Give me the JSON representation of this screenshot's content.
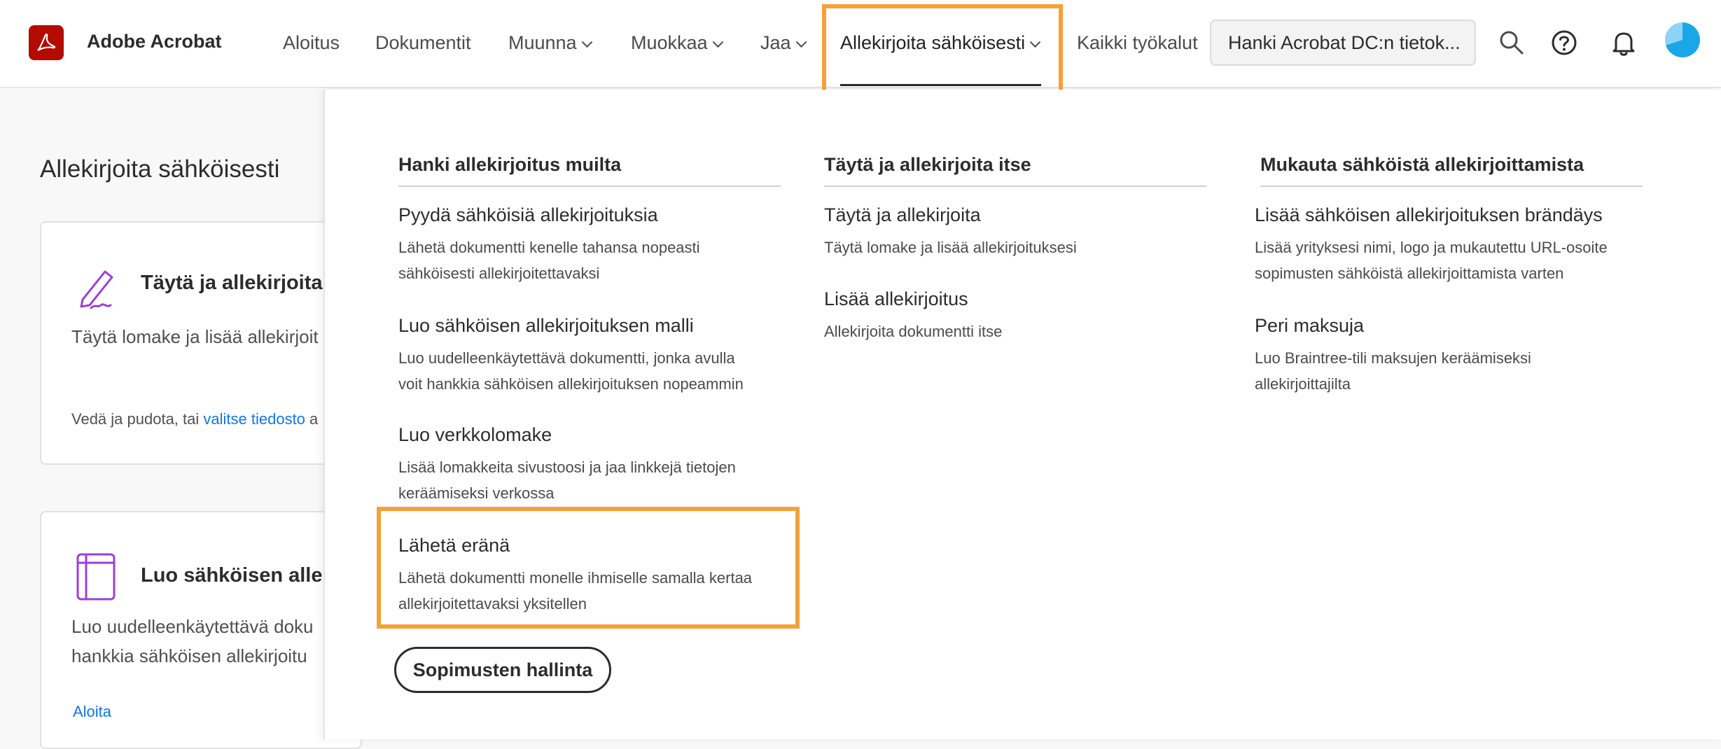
{
  "header": {
    "brand": "Adobe Acrobat",
    "nav": [
      {
        "label": "Aloitus"
      },
      {
        "label": "Dokumentit"
      },
      {
        "label": "Muunna"
      },
      {
        "label": "Muokkaa"
      },
      {
        "label": "Jaa"
      },
      {
        "label": "Allekirjoita sähköisesti"
      },
      {
        "label": "Kaikki työkalut"
      }
    ],
    "cta": "Hanki Acrobat DC:n tietok..."
  },
  "left": {
    "title": "Allekirjoita sähköisesti",
    "card1": {
      "title": "Täytä ja allekirjoita s",
      "text": "Täytä lomake ja lisää allekirjoit",
      "drop_prefix": "Vedä ja pudota, tai",
      "drop_link": "valitse tiedosto",
      "drop_suffix": "a"
    },
    "card2": {
      "title": "Luo sähköisen allek",
      "line1": "Luo uudelleenkäytettävä doku",
      "line2": "hankkia sähköisen allekirjoitu",
      "link": "Aloita"
    }
  },
  "menu": {
    "col1": {
      "heading": "Hanki allekirjoitus muilta",
      "items": [
        {
          "title": "Pyydä sähköisiä allekirjoituksia",
          "desc1": "Lähetä dokumentti kenelle tahansa nopeasti",
          "desc2": "sähköisesti allekirjoitettavaksi"
        },
        {
          "title": "Luo sähköisen allekirjoituksen malli",
          "desc1": "Luo uudelleenkäytettävä dokumentti, jonka avulla",
          "desc2": "voit hankkia sähköisen allekirjoituksen nopeammin"
        },
        {
          "title": "Luo verkkolomake",
          "desc1": "Lisää lomakkeita sivustoosi ja jaa linkkejä tietojen",
          "desc2": "keräämiseksi verkossa"
        },
        {
          "title": "Lähetä eränä",
          "desc1": "Lähetä dokumentti monelle ihmiselle samalla kertaa",
          "desc2": "allekirjoitettavaksi yksitellen"
        }
      ],
      "button": "Sopimusten hallinta"
    },
    "col2": {
      "heading": "Täytä ja allekirjoita itse",
      "items": [
        {
          "title": "Täytä ja allekirjoita",
          "desc1": "Täytä lomake ja lisää allekirjoituksesi"
        },
        {
          "title": "Lisää allekirjoitus",
          "desc1": "Allekirjoita dokumentti itse"
        }
      ]
    },
    "col3": {
      "heading": "Mukauta sähköistä allekirjoittamista",
      "items": [
        {
          "title": "Lisää sähköisen allekirjoituksen brändäys",
          "desc1": "Lisää yrityksesi nimi, logo ja mukautettu URL-osoite",
          "desc2": "sopimusten sähköistä allekirjoittamista varten"
        },
        {
          "title": "Peri maksuja",
          "desc1": "Luo Braintree-tili maksujen keräämiseksi",
          "desc2": "allekirjoittajilta"
        }
      ]
    }
  },
  "colors": {
    "highlight": "#f4a13a",
    "adobe_red": "#b30b00",
    "link": "#1473e6",
    "icon_purple": "#9b3fd6"
  },
  "icons": [
    "adobe-acrobat-logo",
    "search-icon",
    "help-icon",
    "bell-icon",
    "avatar",
    "pen-sign-icon",
    "template-icon"
  ]
}
